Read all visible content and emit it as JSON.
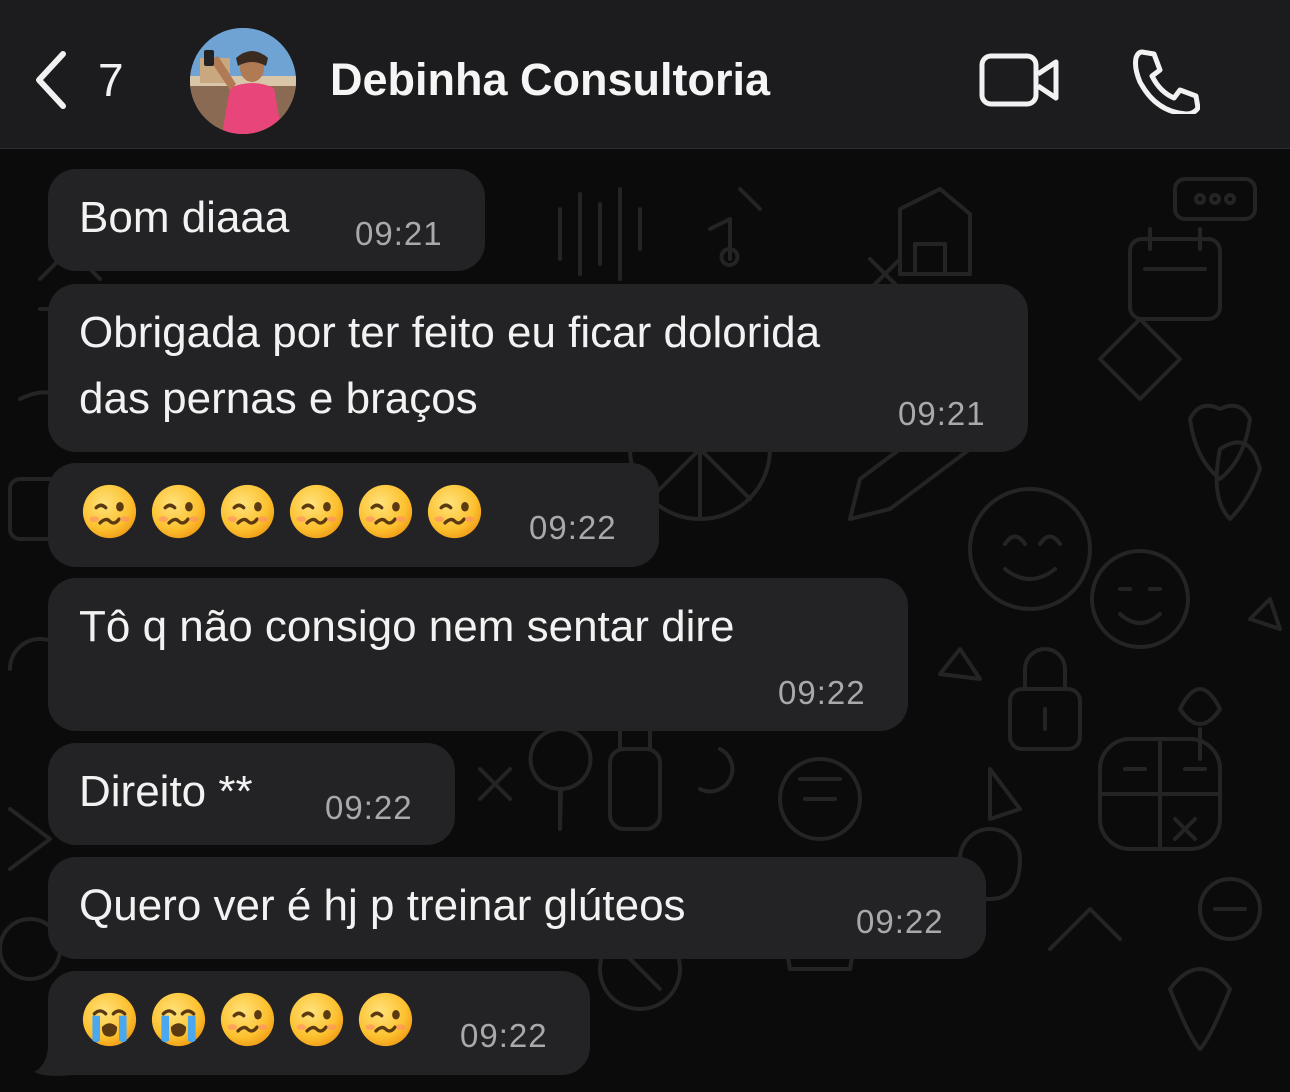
{
  "header": {
    "back_count": "7",
    "title": "Debinha Consultoria",
    "icons": [
      "chevron-left-icon",
      "video-camera-icon",
      "phone-icon"
    ]
  },
  "colors": {
    "header_bg": "#1c1c1e",
    "background": "#0b0b0b",
    "bubble_bg": "#232325",
    "text": "#f2f2f2",
    "time": "#a8a8ad"
  },
  "messages": [
    {
      "text": "Bom diaaa",
      "time": "09:21"
    },
    {
      "text_lines": [
        "Obrigada por ter feito eu ficar dolorida",
        "das pernas e braços"
      ],
      "time": "09:21"
    },
    {
      "emojis": [
        "woozy-face",
        "woozy-face",
        "woozy-face",
        "woozy-face",
        "woozy-face",
        "woozy-face"
      ],
      "time": "09:22"
    },
    {
      "text": "Tô q não consigo nem sentar dire",
      "time": "09:22"
    },
    {
      "text": "Direito **",
      "time": "09:22"
    },
    {
      "text": "Quero ver é hj p treinar glúteos",
      "time": "09:22"
    },
    {
      "emojis": [
        "loudly-crying-face",
        "loudly-crying-face",
        "woozy-face",
        "woozy-face",
        "woozy-face"
      ],
      "time": "09:22"
    }
  ]
}
